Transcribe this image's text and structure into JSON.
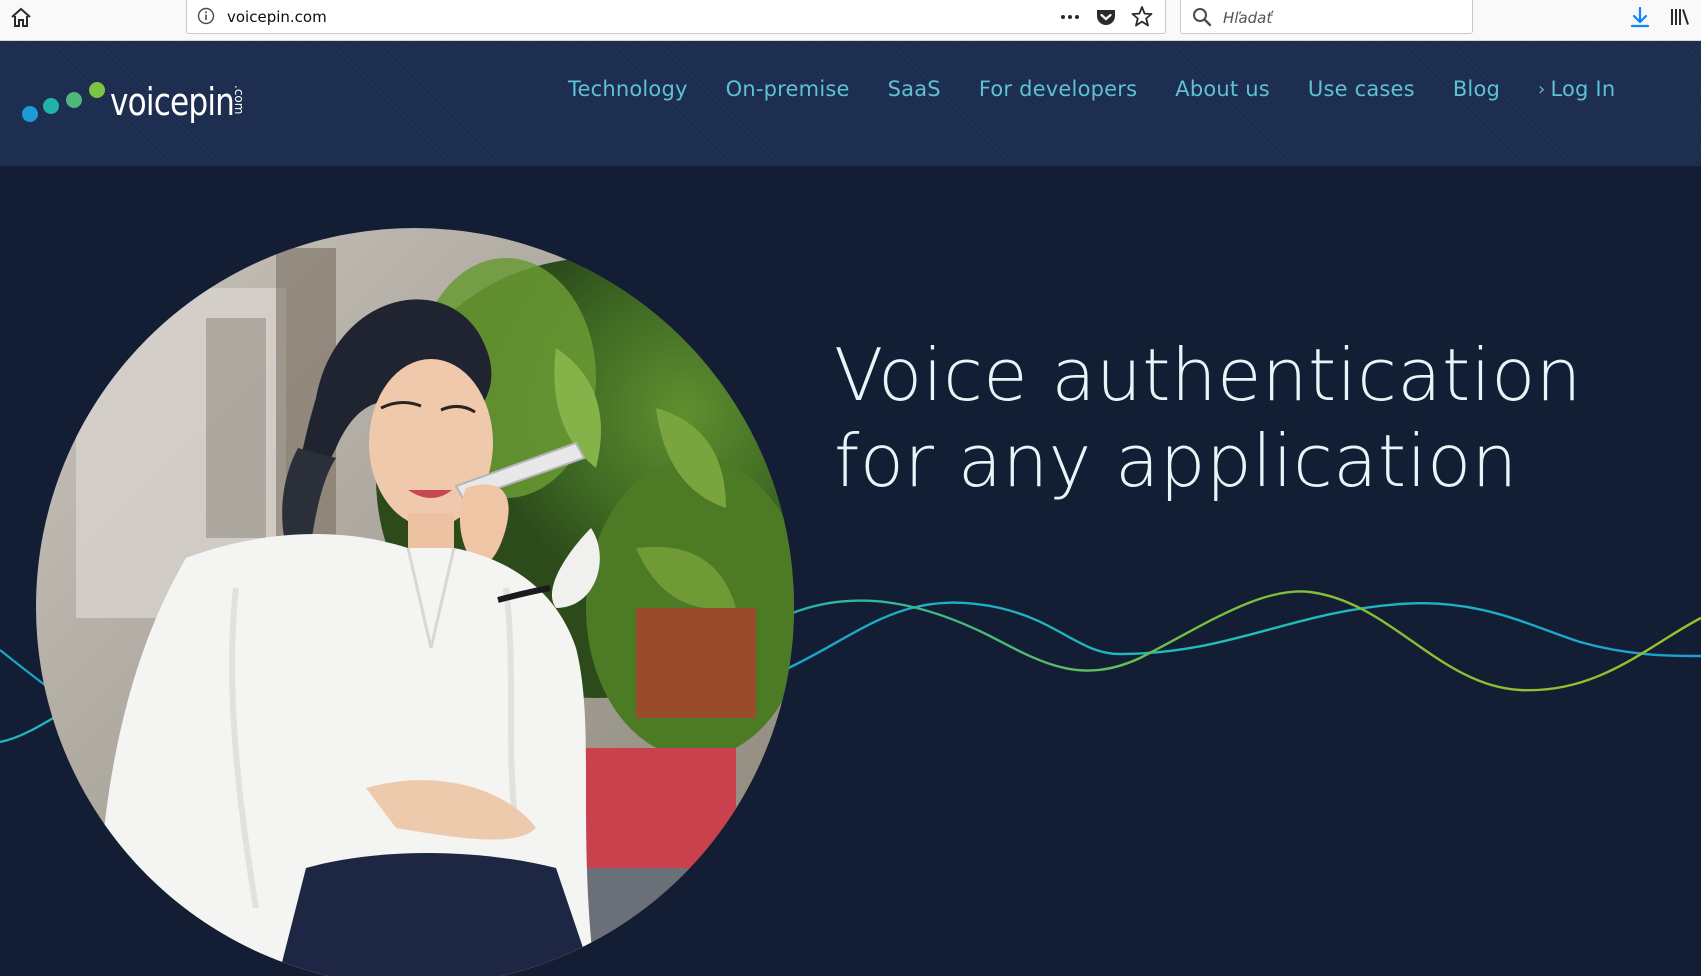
{
  "browser": {
    "url": "voicepin.com",
    "search_placeholder": "Hľadať",
    "icons": [
      "home-icon",
      "info-icon",
      "more-icon",
      "pocket-icon",
      "bookmark-star-icon",
      "search-icon",
      "download-icon",
      "library-icon"
    ]
  },
  "header": {
    "logo_text": "voicepin",
    "logo_suffix": ".com",
    "nav": [
      "Technology",
      "On-premise",
      "SaaS",
      "For developers",
      "About us",
      "Use cases",
      "Blog"
    ],
    "login_label": "Log In"
  },
  "hero": {
    "headline_line1": "Voice authentication",
    "headline_line2": "for any application"
  },
  "colors": {
    "header_bg": "#1b2c4f",
    "hero_bg": "#131d33",
    "nav_text": "#5ec1d4",
    "wave_teal": "#1fb6c4",
    "wave_green": "#8dbb2a",
    "logo_dot_blue": "#1d9bd6",
    "logo_dot_teal": "#21b3a8",
    "logo_dot_green": "#7cc243"
  }
}
